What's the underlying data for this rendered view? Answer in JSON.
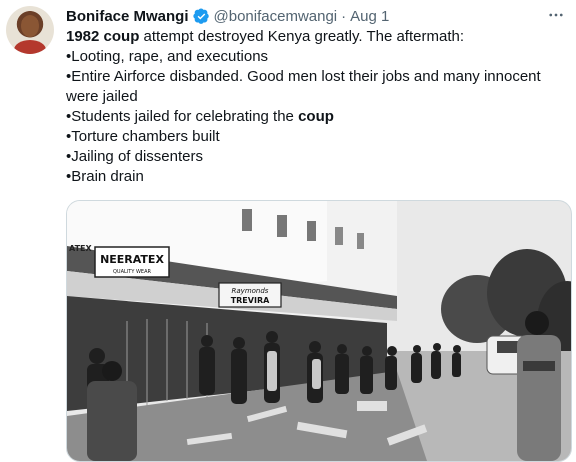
{
  "tweet": {
    "author_name": "Boniface Mwangi",
    "handle": "@bonifacemwangi",
    "date": "Aug 1",
    "icons": [
      "verified-badge-icon",
      "more-options-icon"
    ],
    "lines": [
      {
        "before": "",
        "bold": "1982 coup",
        "after": " attempt destroyed Kenya greatly. The aftermath:"
      },
      {
        "text": "•Looting, rape, and executions"
      },
      {
        "text": "•Entire Airforce disbanded. Good men lost their jobs and many innocent were jailed"
      },
      {
        "before": "•Students jailed for celebrating the ",
        "bold": "coup",
        "after": ""
      },
      {
        "text": "•Torture chambers built"
      },
      {
        "text": "•Jailing of dissenters"
      },
      {
        "text": "•Brain drain"
      }
    ]
  },
  "photo": {
    "sign_neeratex": "NEERATEX",
    "sign_neeratex_sub": "QUALITY WEAR",
    "sign_left": "ATEX",
    "sign_raymonds": "Raymonds",
    "sign_trevira": "TREVIRA"
  },
  "colors": {
    "verified": "#1d9bf0",
    "text": "#0f1419",
    "secondary": "#536471"
  }
}
